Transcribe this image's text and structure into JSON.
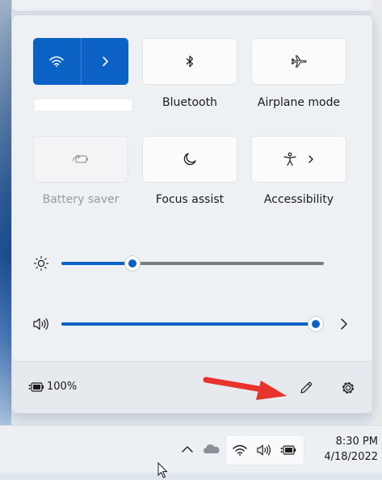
{
  "tiles": {
    "wifi": {
      "name": "",
      "icon": "wifi-icon",
      "state": "on"
    },
    "bluetooth": {
      "label": "Bluetooth",
      "icon": "bluetooth-icon"
    },
    "airplane": {
      "label": "Airplane mode",
      "icon": "airplane-icon"
    },
    "battery_saver": {
      "label": "Battery saver",
      "icon": "battery-saver-icon",
      "state": "disabled"
    },
    "focus_assist": {
      "label": "Focus assist",
      "icon": "moon-icon"
    },
    "accessibility": {
      "label": "Accessibility",
      "icon": "accessibility-icon"
    }
  },
  "sliders": {
    "brightness": {
      "icon": "brightness-icon",
      "value_fraction": 0.27
    },
    "volume": {
      "icon": "speaker-icon",
      "value_fraction": 0.97
    }
  },
  "footer": {
    "battery_percent": "100%",
    "edit_icon": "pencil-icon",
    "settings_icon": "gear-icon"
  },
  "annotation": {
    "arrow_color": "#e8322e"
  },
  "taskbar": {
    "time": "8:30 PM",
    "date": "4/18/2022"
  },
  "colors": {
    "accent": "#0b62c4"
  }
}
